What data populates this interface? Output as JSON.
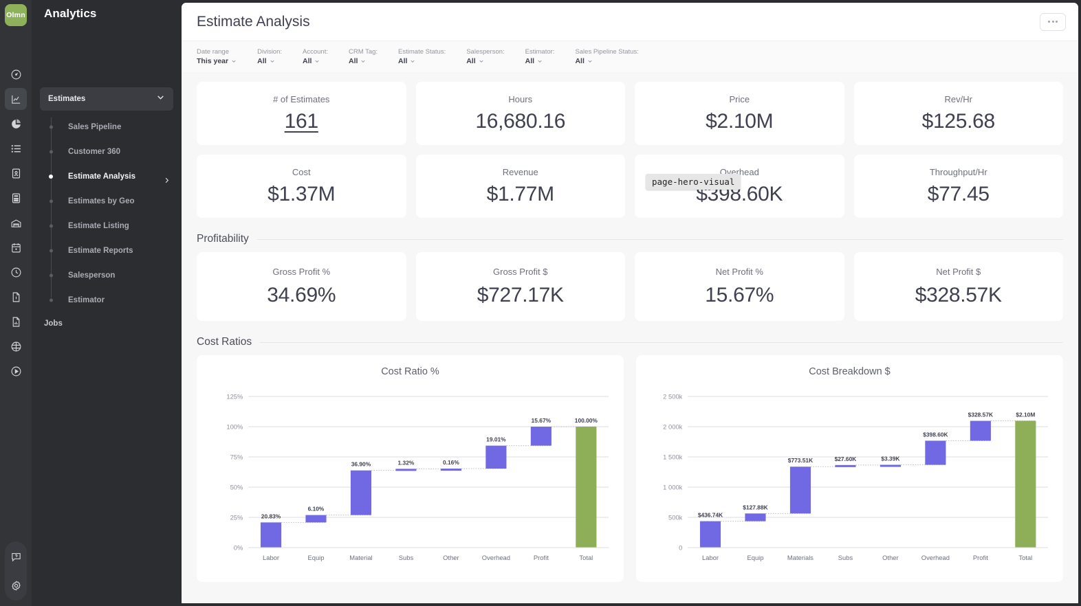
{
  "brand": {
    "logo_text": "Olmn",
    "logo_color": "#8fb15c"
  },
  "nav": {
    "title": "Analytics",
    "group_label": "Estimates",
    "items": [
      {
        "label": "Sales Pipeline",
        "selected": false
      },
      {
        "label": "Customer 360",
        "selected": false
      },
      {
        "label": "Estimate Analysis",
        "selected": true
      },
      {
        "label": "Estimates by Geo",
        "selected": false
      },
      {
        "label": "Estimate Listing",
        "selected": false
      },
      {
        "label": "Estimate Reports",
        "selected": false
      },
      {
        "label": "Salesperson",
        "selected": false
      },
      {
        "label": "Estimator",
        "selected": false
      }
    ],
    "section_label": "Jobs"
  },
  "rail": {
    "icons": [
      "gauge-icon",
      "line-chart-icon",
      "pie-chart-icon",
      "list-icon",
      "contact-card-icon",
      "calculator-icon",
      "warehouse-icon",
      "calendar-icon",
      "clock-icon",
      "document-info-icon",
      "document-chart-icon",
      "globe-icon",
      "play-circle-icon"
    ],
    "bottom_icons": [
      "help-icon",
      "settings-icon"
    ]
  },
  "header": {
    "page_title": "Estimate Analysis",
    "kebab_label": "..."
  },
  "filters": [
    {
      "label": "Date range",
      "value": "This year"
    },
    {
      "label": "Division:",
      "value": "All"
    },
    {
      "label": "Account:",
      "value": "All"
    },
    {
      "label": "CRM Tag:",
      "value": "All"
    },
    {
      "label": "Estimate Status:",
      "value": "All"
    },
    {
      "label": "Salesperson:",
      "value": "All"
    },
    {
      "label": "Estimator:",
      "value": "All"
    },
    {
      "label": "Sales Pipeline Status:",
      "value": "All"
    }
  ],
  "kpis": [
    {
      "label": "# of Estimates",
      "value": "161",
      "underline": true
    },
    {
      "label": "Hours",
      "value": "16,680.16",
      "underline": false
    },
    {
      "label": "Price",
      "value": "$2.10M",
      "underline": false
    },
    {
      "label": "Rev/Hr",
      "value": "$125.68",
      "underline": false
    },
    {
      "label": "Cost",
      "value": "$1.37M",
      "underline": false
    },
    {
      "label": "Revenue",
      "value": "$1.77M",
      "underline": false
    },
    {
      "label": "Overhead",
      "value": "$398.60K",
      "underline": false
    },
    {
      "label": "Throughput/Hr",
      "value": "$77.45",
      "underline": false
    }
  ],
  "profitability": {
    "section_title": "Profitability",
    "cards": [
      {
        "label": "Gross Profit %",
        "value": "34.69%"
      },
      {
        "label": "Gross Profit $",
        "value": "$727.17K"
      },
      {
        "label": "Net Profit %",
        "value": "15.67%"
      },
      {
        "label": "Net Profit $",
        "value": "$328.57K"
      }
    ]
  },
  "cost_ratios": {
    "section_title": "Cost Ratios"
  },
  "overlay": {
    "tooltip_text": "page-hero-visual"
  },
  "colors": {
    "bar_purple": "#7069e3",
    "bar_green": "#8fae58",
    "accent_green": "#8fb15c",
    "text_dark": "#3f4150"
  },
  "chart_data": [
    {
      "type": "bar",
      "subtype": "waterfall",
      "title": "Cost Ratio %",
      "xlabel": "",
      "ylabel": "",
      "categories": [
        "Labor",
        "Equip",
        "Material",
        "Subs",
        "Other",
        "Overhead",
        "Profit",
        "Total"
      ],
      "values": [
        20.83,
        6.1,
        36.9,
        1.32,
        0.16,
        19.01,
        15.67,
        100.0
      ],
      "data_labels": [
        "20.83%",
        "6.10%",
        "36.90%",
        "1.32%",
        "0.16%",
        "19.01%",
        "15.67%",
        "100.00%"
      ],
      "cumulative_start": [
        0,
        20.83,
        26.93,
        63.83,
        65.15,
        65.31,
        84.32,
        0
      ],
      "cumulative_end": [
        20.83,
        26.93,
        63.83,
        65.15,
        65.31,
        84.32,
        99.99,
        100.0
      ],
      "bar_types": [
        "delta",
        "delta",
        "delta",
        "delta",
        "delta",
        "delta",
        "delta",
        "total"
      ],
      "ylim": [
        0,
        125
      ],
      "yticks": [
        0,
        25,
        50,
        75,
        100,
        125
      ],
      "ytick_labels": [
        "0%",
        "25%",
        "50%",
        "75%",
        "100%",
        "125%"
      ],
      "grid": true,
      "legend": "none"
    },
    {
      "type": "bar",
      "subtype": "waterfall",
      "title": "Cost Breakdown $",
      "xlabel": "",
      "ylabel": "",
      "categories": [
        "Labor",
        "Equip",
        "Materials",
        "Subs",
        "Other",
        "Overhead",
        "Profit",
        "Total"
      ],
      "values": [
        436740,
        127880,
        773510,
        27600,
        3390,
        398600,
        328570,
        2097000
      ],
      "data_labels": [
        "$436.74K",
        "$127.88K",
        "$773.51K",
        "$27.60K",
        "$3.39K",
        "$398.60K",
        "$328.57K",
        "$2.10M"
      ],
      "cumulative_start": [
        0,
        436740,
        564620,
        1338130,
        1365730,
        1369120,
        1767720,
        0
      ],
      "cumulative_end": [
        436740,
        564620,
        1338130,
        1365730,
        1369120,
        1767720,
        2096290,
        2097000
      ],
      "bar_types": [
        "delta",
        "delta",
        "delta",
        "delta",
        "delta",
        "delta",
        "delta",
        "total"
      ],
      "ylim": [
        0,
        2500000
      ],
      "yticks": [
        0,
        500000,
        1000000,
        1500000,
        2000000,
        2500000
      ],
      "ytick_labels": [
        "0",
        "500k",
        "1 000k",
        "1 500k",
        "2 000k",
        "2 500k"
      ],
      "grid": true,
      "legend": "none"
    }
  ]
}
